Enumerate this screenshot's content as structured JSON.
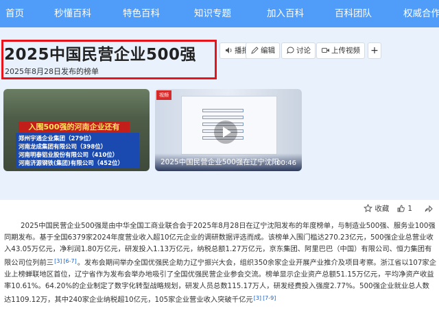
{
  "nav": {
    "items": [
      "首页",
      "秒懂百科",
      "特色百科",
      "知识专题",
      "加入百科",
      "百科团队",
      "权威合作"
    ]
  },
  "header": {
    "title": "2025中国民营企业500强",
    "subtitle": "2025年8月28日发布的榜单"
  },
  "toolbar": {
    "report": "播报",
    "edit": "编辑",
    "discuss": "讨论",
    "upload_video": "上传视频",
    "add": "+"
  },
  "media": {
    "card1": {
      "banner": "入围500强的河南企业还有",
      "lines": [
        "郑州宇通企业集团（279位）",
        "河南龙成集团有限公司（398位）",
        "河南明泰铝业股份有限公司（410位）",
        "河南济源钢铁(集团)有限公司（452位）"
      ]
    },
    "card2": {
      "badge": "视频",
      "caption": "2025中国民营企业500强在辽宁沈阳发布",
      "duration": "00:46"
    }
  },
  "actions": {
    "favorite": "收藏",
    "likes": "1"
  },
  "article": {
    "p1_a": "2025中国民营企业500强是由中华全国工商业联合会于2025年8月28日在辽宁沈阳发布的年度榜单，与制造业500强、服务业100强同期发布。基于全国6379家2024年度营业收入超10亿元企业的调研数据评选而成。该榜单入围门槛达270.23亿元，500强企业总营业收入43.05万亿元，净利润1.80万亿元，研发投入1.13万亿元，纳税总额1.27万亿元，京东集团、阿里巴巴（中国）有限公司、恒力集团有限公司位列前三",
    "ref_a1": "[3]",
    "ref_a2": "[6-7]",
    "p1_b": "。发布会期间举办全国优强民企助力辽宁振兴大会，组织350余家企业开展产业推介及项目考察。浙江省以107家企业上榜蝉联地区首位，辽宁省作为发布会举办地吸引了全国优强民营企业参会交流。榜单显示企业资产总额51.15万亿元，平均净资产收益率10.61%。64.20%的企业制定了数字化转型战略规划，研发人员总数115.17万人，研发经费投入强度2.77%。500强企业就业总人数达1109.12万，其中240家企业纳税超10亿元，105家企业营业收入突破千亿元",
    "ref_b1": "[3]",
    "ref_b2": "[7-9]"
  },
  "colors": {
    "nav_bg": "#4f9cf9",
    "band_bg": "#e8f1fc",
    "highlight_border": "#e8141b",
    "link": "#1d5fc9"
  }
}
